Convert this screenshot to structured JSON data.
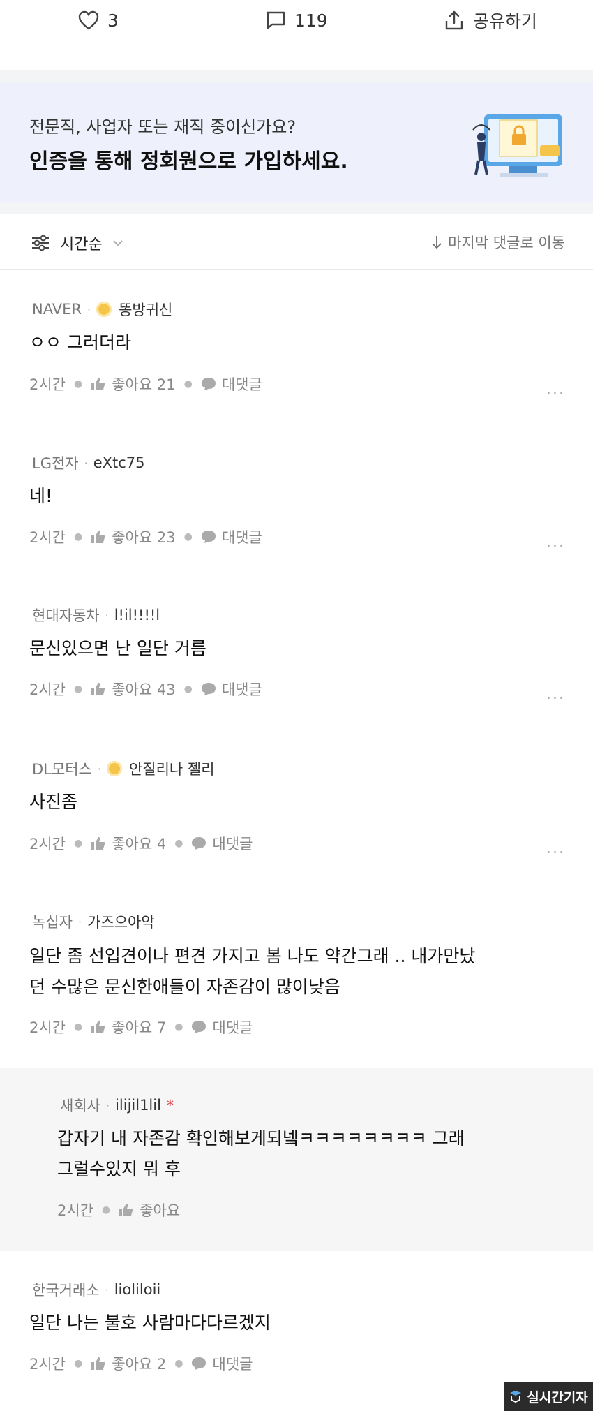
{
  "actions": {
    "like_count": "3",
    "comment_count": "119",
    "share_label": "공유하기"
  },
  "banner": {
    "subtitle": "전문직, 사업자 또는 재직 중이신가요?",
    "title": "인증을 통해 정회원으로 가입하세요."
  },
  "sort": {
    "label": "시간순",
    "jump_label": "마지막 댓글로 이동"
  },
  "comments": [
    {
      "company": "NAVER",
      "badge": true,
      "author": "똥방귀신",
      "text": "ㅇㅇ 그러더라",
      "time": "2시간",
      "likes": "좋아요 21",
      "reply": "대댓글"
    },
    {
      "company": "LG전자",
      "badge": false,
      "author": "eXtc75",
      "text": "네!",
      "time": "2시간",
      "likes": "좋아요 23",
      "reply": "대댓글"
    },
    {
      "company": "현대자동차",
      "badge": false,
      "author": "l!il!!!!l",
      "text": "문신있으면 난 일단 거름",
      "time": "2시간",
      "likes": "좋아요 43",
      "reply": "대댓글"
    },
    {
      "company": "DL모터스",
      "badge": true,
      "author": "안질리나 젤리",
      "text": "사진좀",
      "time": "2시간",
      "likes": "좋아요 4",
      "reply": "대댓글"
    },
    {
      "company": "녹십자",
      "badge": false,
      "author": "가즈으아악",
      "text_line1": "일단 좀 선입견이나 편견 가지고 봄 나도 약간그래 .. 내가만났",
      "text_line2": "던 수많은 문신한애들이 자존감이 많이낮음",
      "time": "2시간",
      "likes": "좋아요 7",
      "reply": "대댓글"
    },
    {
      "company": "새회사",
      "author": "ilijil1lil",
      "star": "*",
      "text_line1": "갑자기 내 자존감 확인해보게되넼ㅋㅋㅋㅋㅋㅋㅋㅋ 그래",
      "text_line2": "그럴수있지 뭐 후",
      "time": "2시간",
      "likes": "좋아요"
    },
    {
      "company": "한국거래소",
      "badge": false,
      "author": "lioliloii",
      "text": "일단 나는 불호 사람마다다르겠지",
      "time": "2시간",
      "likes": "좋아요 2",
      "reply": "대댓글"
    }
  ],
  "more_label": "...",
  "watermark": "실시간기자",
  "icons": {
    "like": "heart-icon",
    "comment": "comment-icon",
    "share": "share-icon",
    "sort": "sliders-icon",
    "thumb": "thumbs-up-icon",
    "bubble": "chat-bubble-icon"
  },
  "colors": {
    "banner_bg": "#eef1fb",
    "reply_bg": "#f6f6f6",
    "badge": "#f5c44a",
    "star": "#e04040"
  }
}
